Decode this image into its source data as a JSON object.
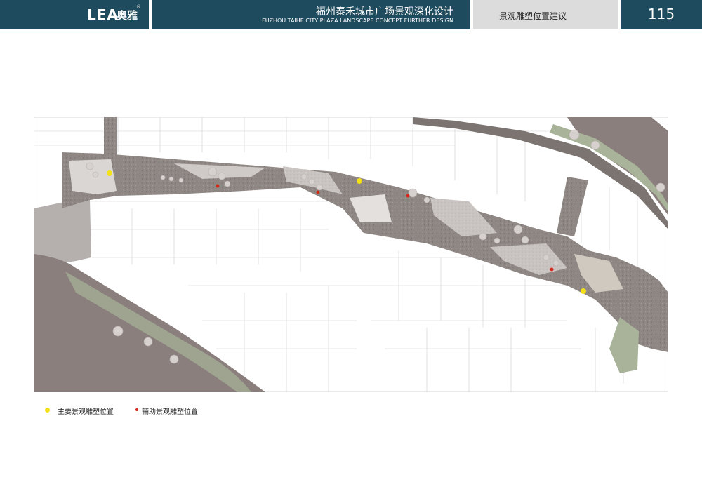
{
  "header": {
    "logo_text": "LEA",
    "logo_cn": "奥雅",
    "logo_reg": "®",
    "title_cn": "福州泰禾城市广场景观深化设计",
    "title_en": "FUZHOU TAIHE CITY PLAZA LANDSCAPE CONCEPT FURTHER DESIGN",
    "section": "景观雕塑位置建议",
    "page_number": "115"
  },
  "colors": {
    "header_blue": "#1f4b5e",
    "header_gray": "#dcdcdc",
    "main_sculpture": "#f5e11a",
    "aux_sculpture": "#d42a1c",
    "paving": "#8e8582",
    "river": "#8a7f7c"
  },
  "legend": [
    {
      "label": "主要景观雕塑位置",
      "color": "#f5e11a"
    },
    {
      "label": "辅助景观雕塑位置",
      "color": "#d42a1c"
    }
  ]
}
